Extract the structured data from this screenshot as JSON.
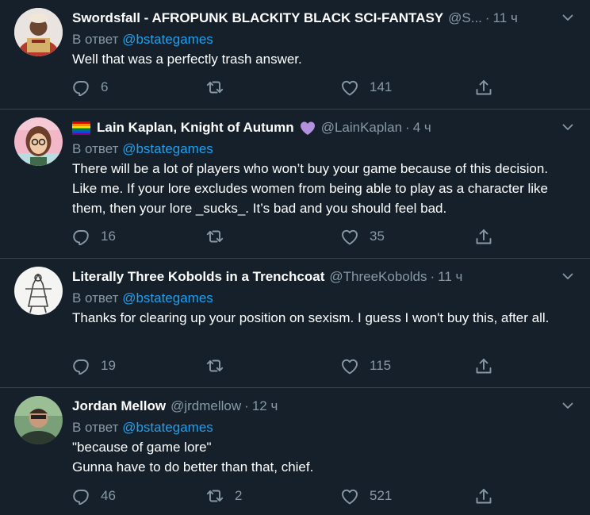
{
  "common": {
    "reply_prefix": "В ответ",
    "reply_to": "@bstategames"
  },
  "tweets": [
    {
      "name": "Swordsfall - AFROPUNK BLACKITY BLACK SCI-FANTASY",
      "handle": "@S...",
      "time": "11 ч",
      "text": "Well that was a perfectly trash answer.",
      "replies": "6",
      "retweets": "",
      "likes": "141"
    },
    {
      "name": "Lain Kaplan, Knight of Autumn",
      "handle": "@LainKaplan",
      "time": "4 ч",
      "text": "There will be a lot of players who won’t buy your game because of this decision. Like me. If your lore excludes women from being able to play as a character like them, then your lore _sucks_. It’s bad and you should feel bad.",
      "replies": "16",
      "retweets": "",
      "likes": "35"
    },
    {
      "name": "Literally Three Kobolds in a Trenchcoat",
      "handle": "@ThreeKobolds",
      "time": "11 ч",
      "text": "Thanks for clearing up your position on sexism. I guess I won't buy this, after all.",
      "replies": "19",
      "retweets": "",
      "likes": "115"
    },
    {
      "name": "Jordan Mellow",
      "handle": "@jrdmellow",
      "time": "12 ч",
      "text_line1": "\"because of game lore\"",
      "text_line2": "Gunna have to do better than that, chief.",
      "replies": "46",
      "retweets": "2",
      "likes": "521"
    }
  ],
  "separator": "·",
  "colors": {
    "background": "#15202b",
    "muted": "#8899a6",
    "link": "#1da1f2",
    "divider": "#38444d",
    "heart_emoji": "#b391dd"
  }
}
